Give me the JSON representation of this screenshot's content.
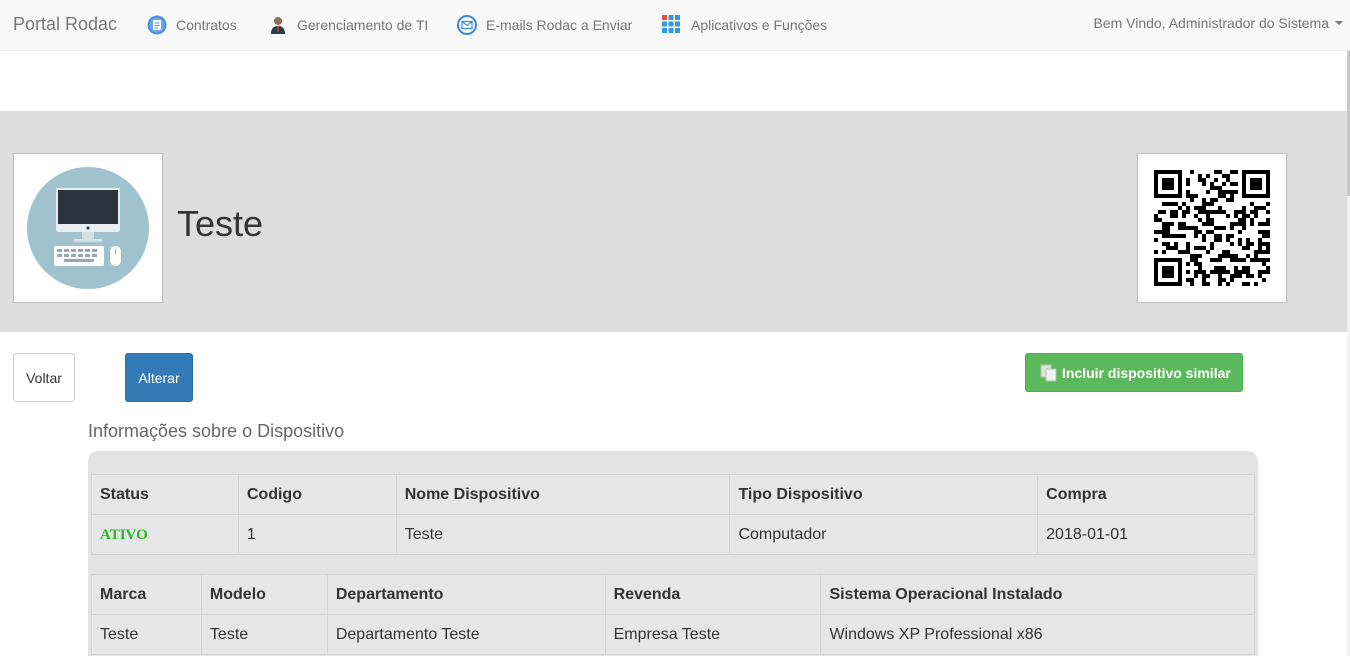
{
  "navbar": {
    "brand": "Portal Rodac",
    "items": [
      {
        "label": "Contratos",
        "icon": "contract-icon"
      },
      {
        "label": "Gerenciamento de TI",
        "icon": "admin-user-icon"
      },
      {
        "label": "E-mails Rodac a Enviar",
        "icon": "email-icon"
      },
      {
        "label": "Aplicativos e Funções",
        "icon": "apps-grid-icon"
      }
    ],
    "user_menu": "Bem Vindo, Administrador do Sistema"
  },
  "device": {
    "name": "Teste",
    "image_icon": "computer-icon",
    "qr_icon": "qr-code-icon"
  },
  "actions": {
    "back": "Voltar",
    "edit": "Alterar",
    "add_similar": "Incluir dispositivo similar"
  },
  "section_title": "Informações sobre o Dispositivo",
  "table1": {
    "headers": [
      "Status",
      "Codigo",
      "Nome Dispositivo",
      "Tipo Dispositivo",
      "Compra"
    ],
    "row": [
      "ATIVO",
      "1",
      "Teste",
      "Computador",
      "2018-01-01"
    ]
  },
  "table2": {
    "headers": [
      "Marca",
      "Modelo",
      "Departamento",
      "Revenda",
      "Sistema Operacional Instalado"
    ],
    "row": [
      "Teste",
      "Teste",
      "Departamento Teste",
      "Empresa Teste",
      "Windows XP Professional x86"
    ]
  },
  "colors": {
    "navbar_bg": "#f8f8f8",
    "header_band": "#dddddd",
    "primary": "#337ab7",
    "success": "#5cb85c",
    "status_active": "#22bb22"
  }
}
